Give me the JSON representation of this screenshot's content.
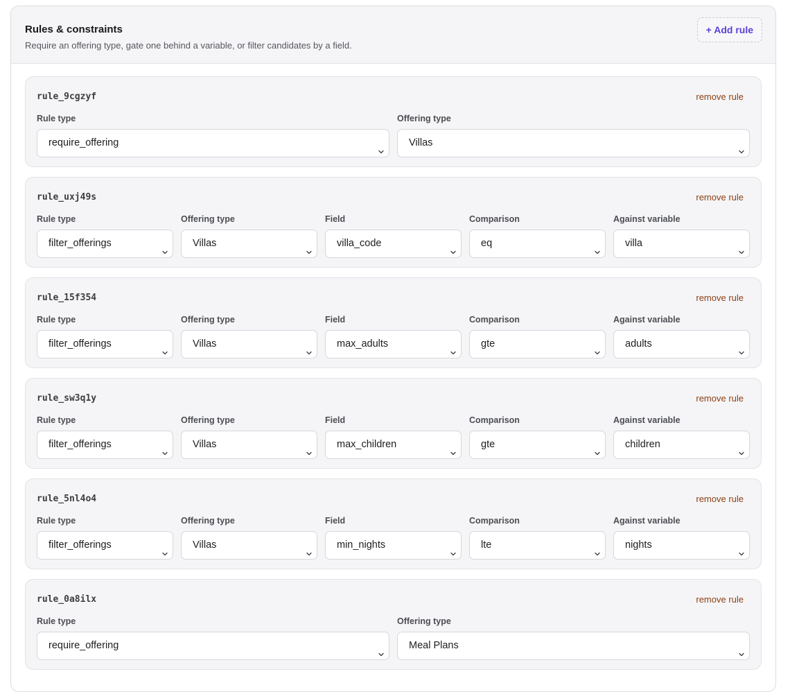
{
  "header": {
    "title": "Rules & constraints",
    "subtitle": "Require an offering type, gate one behind a variable, or filter candidates by a field.",
    "add_rule_label": "+ Add rule"
  },
  "remove_label": "remove rule",
  "rules": [
    {
      "id": "rule_9cgzyf",
      "fields": [
        {
          "label": "Rule type",
          "value": "require_offering"
        },
        {
          "label": "Offering type",
          "value": "Villas"
        }
      ]
    },
    {
      "id": "rule_uxj49s",
      "fields": [
        {
          "label": "Rule type",
          "value": "filter_offerings"
        },
        {
          "label": "Offering type",
          "value": "Villas"
        },
        {
          "label": "Field",
          "value": "villa_code"
        },
        {
          "label": "Comparison",
          "value": "eq"
        },
        {
          "label": "Against variable",
          "value": "villa"
        }
      ]
    },
    {
      "id": "rule_15f354",
      "fields": [
        {
          "label": "Rule type",
          "value": "filter_offerings"
        },
        {
          "label": "Offering type",
          "value": "Villas"
        },
        {
          "label": "Field",
          "value": "max_adults"
        },
        {
          "label": "Comparison",
          "value": "gte"
        },
        {
          "label": "Against variable",
          "value": "adults"
        }
      ]
    },
    {
      "id": "rule_sw3q1y",
      "fields": [
        {
          "label": "Rule type",
          "value": "filter_offerings"
        },
        {
          "label": "Offering type",
          "value": "Villas"
        },
        {
          "label": "Field",
          "value": "max_children"
        },
        {
          "label": "Comparison",
          "value": "gte"
        },
        {
          "label": "Against variable",
          "value": "children"
        }
      ]
    },
    {
      "id": "rule_5nl4o4",
      "fields": [
        {
          "label": "Rule type",
          "value": "filter_offerings"
        },
        {
          "label": "Offering type",
          "value": "Villas"
        },
        {
          "label": "Field",
          "value": "min_nights"
        },
        {
          "label": "Comparison",
          "value": "lte"
        },
        {
          "label": "Against variable",
          "value": "nights"
        }
      ]
    },
    {
      "id": "rule_0a8ilx",
      "fields": [
        {
          "label": "Rule type",
          "value": "require_offering"
        },
        {
          "label": "Offering type",
          "value": "Meal Plans"
        }
      ]
    }
  ]
}
